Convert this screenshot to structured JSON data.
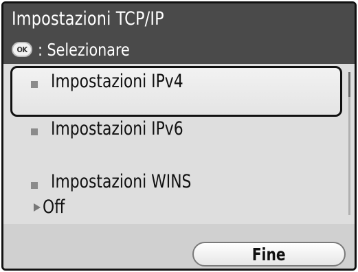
{
  "header": {
    "title": "Impostazioni TCP/IP",
    "hint_icon": "ok-icon",
    "hint_icon_label": "OK",
    "hint_text": ": Selezionare"
  },
  "list": {
    "items": [
      {
        "label": "Impostazioni IPv4",
        "selected": true
      },
      {
        "label": "Impostazioni IPv6",
        "selected": false
      },
      {
        "label": "Impostazioni WINS",
        "selected": false,
        "sub_icon": "triangle-right-icon",
        "sub_value": "Off"
      }
    ]
  },
  "footer": {
    "done_label": "Fine"
  },
  "colors": {
    "header_bg": "#4a4a4a",
    "list_bg": "#dedede",
    "selection_border": "#111111"
  }
}
